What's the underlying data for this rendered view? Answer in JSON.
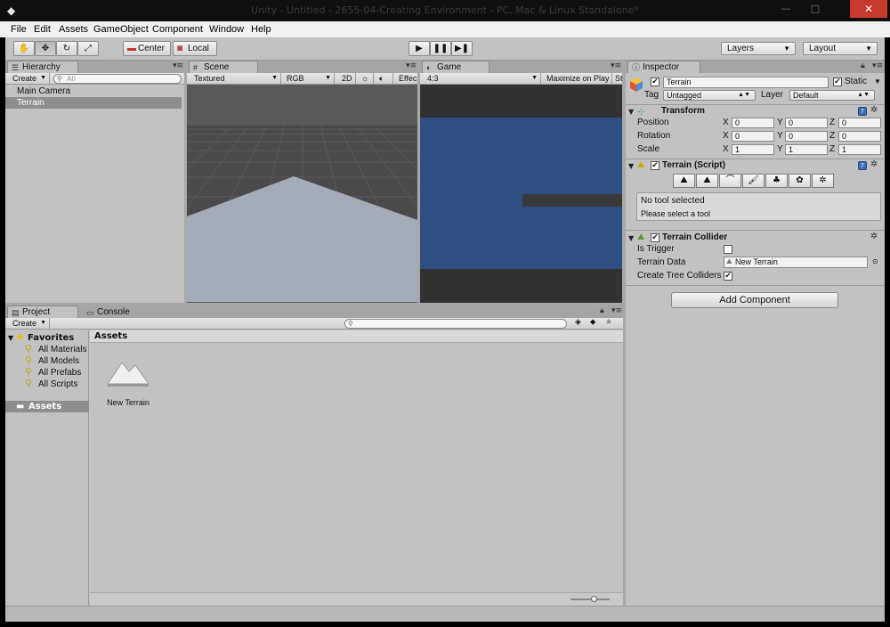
{
  "window": {
    "title": "Unity - Untitled - 2655-04-Creating Environment - PC, Mac & Linux Standalone*",
    "minimize_glyph": "—",
    "maximize_glyph": "□",
    "close_glyph": "✕"
  },
  "menu": [
    "File",
    "Edit",
    "Assets",
    "GameObject",
    "Component",
    "Window",
    "Help"
  ],
  "toolbar": {
    "center_label": "Center",
    "local_label": "Local",
    "layers_label": "Layers",
    "layout_label": "Layout"
  },
  "hierarchy": {
    "tab": "Hierarchy",
    "create_label": "Create",
    "search_placeholder": "All",
    "items": [
      {
        "label": "Main Camera",
        "selected": false
      },
      {
        "label": "Terrain",
        "selected": true
      }
    ]
  },
  "scene": {
    "tab": "Scene",
    "shading": "Textured",
    "render_mode": "RGB",
    "mode_2d": "2D",
    "effects": "Effec"
  },
  "game": {
    "tab": "Game",
    "aspect": "4:3",
    "maximize": "Maximize on Play",
    "stats": "St"
  },
  "inspector": {
    "tab": "Inspector",
    "object_name": "Terrain",
    "static_label": "Static",
    "tag_label": "Tag",
    "tag_value": "Untagged",
    "layer_label": "Layer",
    "layer_value": "Default",
    "transform": {
      "title": "Transform",
      "position_label": "Position",
      "rotation_label": "Rotation",
      "scale_label": "Scale",
      "axis_x": "X",
      "axis_y": "Y",
      "axis_z": "Z",
      "position": [
        "0",
        "0",
        "0"
      ],
      "rotation": [
        "0",
        "0",
        "0"
      ],
      "scale": [
        "1",
        "1",
        "1"
      ]
    },
    "terrain_script": {
      "title": "Terrain (Script)",
      "status_line1": "No tool selected",
      "status_line2": "Please select a tool"
    },
    "terrain_collider": {
      "title": "Terrain Collider",
      "is_trigger_label": "Is Trigger",
      "terrain_data_label": "Terrain Data",
      "terrain_data_value": "New Terrain",
      "create_tree_collider_label": "Create Tree Colliders",
      "is_trigger": false,
      "create_tree_colliders": true
    },
    "add_component_label": "Add Component"
  },
  "project": {
    "tab": "Project",
    "console_tab": "Console",
    "create_label": "Create",
    "favorites_label": "Favorites",
    "favorites": [
      "All Materials",
      "All Models",
      "All Prefabs",
      "All Scripts"
    ],
    "assets_label": "Assets",
    "breadcrumb": "Assets",
    "asset_items": [
      {
        "label": "New Terrain"
      }
    ]
  },
  "colors": {
    "game_sky": "#2f4f82",
    "selection": "#8e8e8e",
    "close_button": "#c73a2e"
  }
}
